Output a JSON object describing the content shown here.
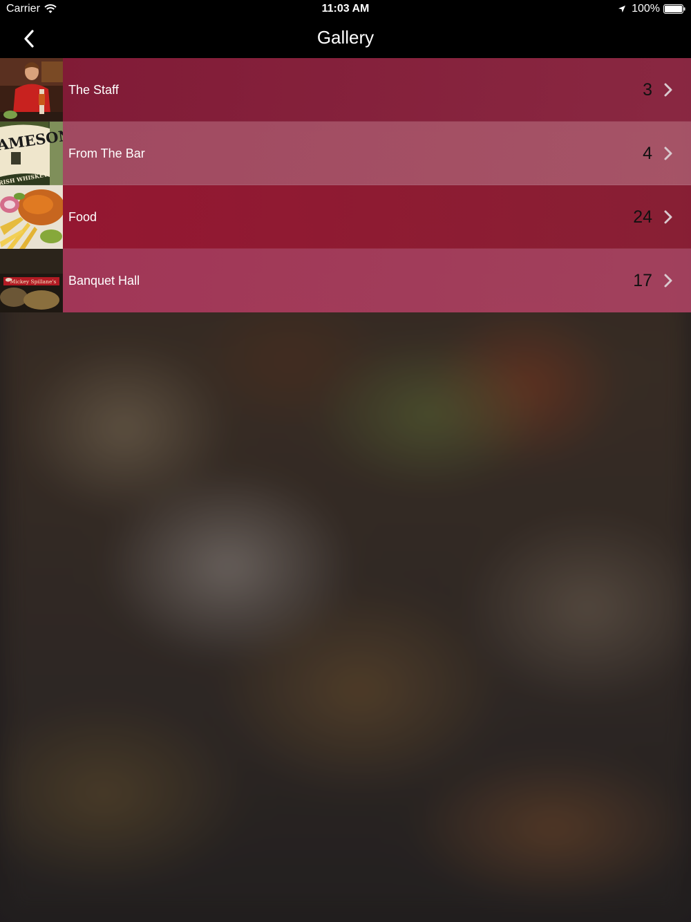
{
  "status_bar": {
    "carrier": "Carrier",
    "time": "11:03 AM",
    "battery": "100%"
  },
  "nav": {
    "title": "Gallery",
    "back_icon": "chevron-left-icon"
  },
  "gallery": {
    "items": [
      {
        "label": "The Staff",
        "count": "3",
        "thumbnail": "bartender-photo"
      },
      {
        "label": "From The Bar",
        "count": "4",
        "thumbnail": "whiskey-bottle-photo"
      },
      {
        "label": "Food",
        "count": "24",
        "thumbnail": "burger-fries-photo"
      },
      {
        "label": "Banquet Hall",
        "count": "17",
        "thumbnail": "mickey-spillanes-logo-photo"
      }
    ]
  },
  "thumbnail_text": {
    "whiskey_brand": "AMESON",
    "whiskey_sub": "IRISH WHISKEY",
    "banquet_sign": "Mickey Spillane's"
  },
  "colors": {
    "nav_background": "#000000",
    "row_tint": "#9a2245",
    "count_text": "#111111",
    "chevron": "#d9c9cf"
  }
}
